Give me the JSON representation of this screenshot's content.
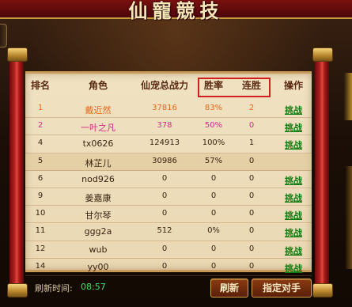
{
  "window": {
    "title": "仙寵競技"
  },
  "table": {
    "headers": {
      "rank": "排名",
      "role": "角色",
      "power": "仙宠总战力",
      "win_rate": "胜率",
      "streak": "连胜",
      "operation": "操作"
    },
    "rows": [
      {
        "rank": "1",
        "name": "戴近然",
        "power": "37816",
        "win_rate": "83%",
        "streak": "2",
        "action": "挑战"
      },
      {
        "rank": "2",
        "name": "一叶之凡",
        "power": "378",
        "win_rate": "50%",
        "streak": "0",
        "action": "挑战"
      },
      {
        "rank": "4",
        "name": "tx0626",
        "power": "124913",
        "win_rate": "100%",
        "streak": "1",
        "action": "挑战"
      },
      {
        "rank": "5",
        "name": "林芷儿",
        "power": "30986",
        "win_rate": "57%",
        "streak": "0",
        "action": ""
      },
      {
        "rank": "6",
        "name": "nod926",
        "power": "0",
        "win_rate": "0",
        "streak": "0",
        "action": "挑战"
      },
      {
        "rank": "9",
        "name": "姜嘉康",
        "power": "0",
        "win_rate": "0",
        "streak": "0",
        "action": "挑战"
      },
      {
        "rank": "10",
        "name": "甘尔琴",
        "power": "0",
        "win_rate": "0",
        "streak": "0",
        "action": "挑战"
      },
      {
        "rank": "11",
        "name": "ggg2a",
        "power": "512",
        "win_rate": "0%",
        "streak": "0",
        "action": "挑战"
      },
      {
        "rank": "12",
        "name": "wub",
        "power": "0",
        "win_rate": "0",
        "streak": "0",
        "action": "挑战"
      },
      {
        "rank": "14",
        "name": "yy00",
        "power": "0",
        "win_rate": "0",
        "streak": "0",
        "action": "挑战"
      }
    ]
  },
  "footer": {
    "refresh_time_label": "刷新时间:",
    "refresh_time_value": "08:57",
    "refresh_button": "刷新",
    "assign_button": "指定对手"
  },
  "colors": {
    "rank1": "#e36a1a",
    "rank2": "#d12a8a",
    "action_link": "#0f7a0f",
    "timer": "#49e05a",
    "highlight_box": "#d11f1f"
  }
}
